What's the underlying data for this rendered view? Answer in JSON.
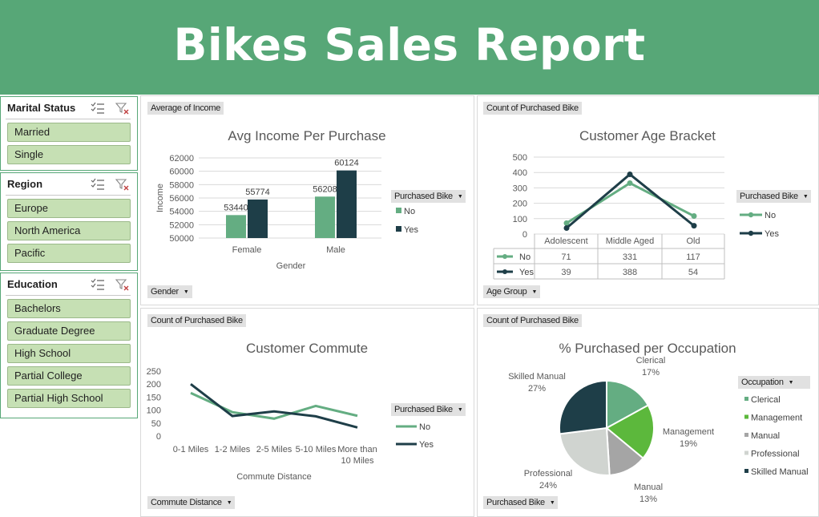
{
  "title": "Bikes Sales Report",
  "colors": {
    "header": "#57a777",
    "no": "#64ad82",
    "yes": "#1e3e48",
    "slicer_item": "#c6e0b4"
  },
  "slicers": [
    {
      "title": "Marital Status",
      "items": [
        "Married",
        "Single"
      ]
    },
    {
      "title": "Region",
      "items": [
        "Europe",
        "North America",
        "Pacific"
      ]
    },
    {
      "title": "Education",
      "items": [
        "Bachelors",
        "Graduate Degree",
        "High School",
        "Partial College",
        "Partial High School"
      ]
    }
  ],
  "slicer_icons": [
    "multi-select-icon",
    "clear-filter-icon"
  ],
  "income_panel": {
    "field_value": "Average of Income",
    "field_axis": "Gender",
    "legend_field": "Purchased Bike",
    "y_ticks": [
      "62000",
      "60000",
      "58000",
      "56000",
      "54000",
      "52000",
      "50000"
    ],
    "chart_data": {
      "type": "bar",
      "title": "Avg Income Per Purchase",
      "xlabel": "Gender",
      "ylabel": "Income",
      "categories": [
        "Female",
        "Male"
      ],
      "ylim": [
        50000,
        62000
      ],
      "series": [
        {
          "name": "No",
          "values": [
            53440,
            56208
          ],
          "color": "#64ad82"
        },
        {
          "name": "Yes",
          "values": [
            55774,
            60124
          ],
          "color": "#1e3e48"
        }
      ]
    }
  },
  "age_panel": {
    "field_value": "Count of Purchased Bike",
    "field_axis": "Age Group",
    "legend_field": "Purchased Bike",
    "y_ticks": [
      "500",
      "400",
      "300",
      "200",
      "100",
      "0"
    ],
    "chart_data": {
      "type": "line",
      "title": "Customer Age Bracket",
      "categories": [
        "Adolescent",
        "Middle Aged",
        "Old"
      ],
      "ylim": [
        0,
        500
      ],
      "series": [
        {
          "name": "No",
          "values": [
            71,
            331,
            117
          ],
          "color": "#64ad82"
        },
        {
          "name": "Yes",
          "values": [
            39,
            388,
            54
          ],
          "color": "#1e3e48"
        }
      ]
    },
    "table": {
      "rows": [
        {
          "label": "No",
          "values": [
            "71",
            "331",
            "117"
          ]
        },
        {
          "label": "Yes",
          "values": [
            "39",
            "388",
            "54"
          ]
        }
      ]
    }
  },
  "commute_panel": {
    "field_value": "Count of Purchased Bike",
    "field_axis": "Commute Distance",
    "legend_field": "Purchased Bike",
    "y_ticks": [
      "250",
      "200",
      "150",
      "100",
      "50",
      "0"
    ],
    "x_labels": [
      [
        "0-1 Miles"
      ],
      [
        "1-2 Miles"
      ],
      [
        "2-5 Miles"
      ],
      [
        "5-10 Miles"
      ],
      [
        "More than",
        "10 Miles"
      ]
    ],
    "chart_data": {
      "type": "line",
      "title": "Customer Commute",
      "xlabel": "Commute  Distance",
      "categories": [
        "0-1 Miles",
        "1-2 Miles",
        "2-5 Miles",
        "5-10 Miles",
        "More than 10 Miles"
      ],
      "ylim": [
        0,
        250
      ],
      "series": [
        {
          "name": "No",
          "values": [
            166,
            92,
            67,
            116,
            78
          ],
          "color": "#64ad82"
        },
        {
          "name": "Yes",
          "values": [
            200,
            77,
            95,
            76,
            33
          ],
          "color": "#1e3e48"
        }
      ]
    }
  },
  "occupation_panel": {
    "field_value": "Count of Purchased Bike",
    "field_filter": "Purchased Bike",
    "legend_field": "Occupation",
    "chart_data": {
      "type": "pie",
      "title": "% Purchased per Occupation",
      "slices": [
        {
          "label": "Clerical",
          "pct_label": "17%",
          "value": 17,
          "color": "#64ad82"
        },
        {
          "label": "Management",
          "pct_label": "19%",
          "value": 19,
          "color": "#5cb83c"
        },
        {
          "label": "Manual",
          "pct_label": "13%",
          "value": 13,
          "color": "#a5a5a5"
        },
        {
          "label": "Professional",
          "pct_label": "24%",
          "value": 24,
          "color": "#d0d4d0"
        },
        {
          "label": "Skilled Manual",
          "pct_label": "27%",
          "value": 27,
          "color": "#1e3e48"
        }
      ]
    }
  }
}
